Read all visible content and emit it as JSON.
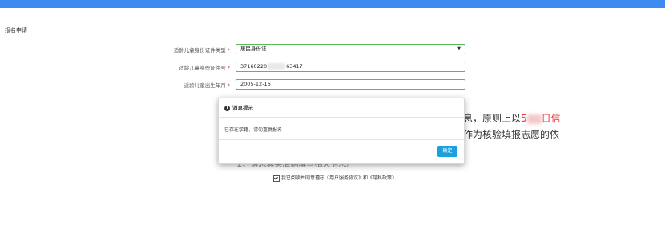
{
  "page": {
    "section_title": "报名申请"
  },
  "form": {
    "fields": [
      {
        "label": "适龄儿童身份证件类型",
        "required_mark": "*",
        "value": "居民身份证"
      },
      {
        "label": "适龄儿童身份证件号",
        "required_mark": "*",
        "value_prefix": "37160220",
        "value_suffix": "63417"
      },
      {
        "label": "适龄儿童出生年月",
        "required_mark": "*",
        "value": "2005-12-16"
      }
    ]
  },
  "background_notice": {
    "line1_left": "息，原则上以",
    "line1_red": "5",
    "line1_red_end": "日信",
    "line2": "作为核验填报志愿的依",
    "line3": "2、请您真实准确填写相关信息。"
  },
  "agreement": {
    "text": "我已阅读并同意遵守《用户服务协议》和《隐私政策》",
    "checked": true
  },
  "modal": {
    "title": "消息提示",
    "message": "已存在学籍，请勿重复报名",
    "ok_label": "确定"
  },
  "colors": {
    "topbar": "#3d8bf0",
    "field_border": "#5cb85c",
    "ok_button": "#1ea0e0",
    "highlight_red": "#e33333"
  }
}
